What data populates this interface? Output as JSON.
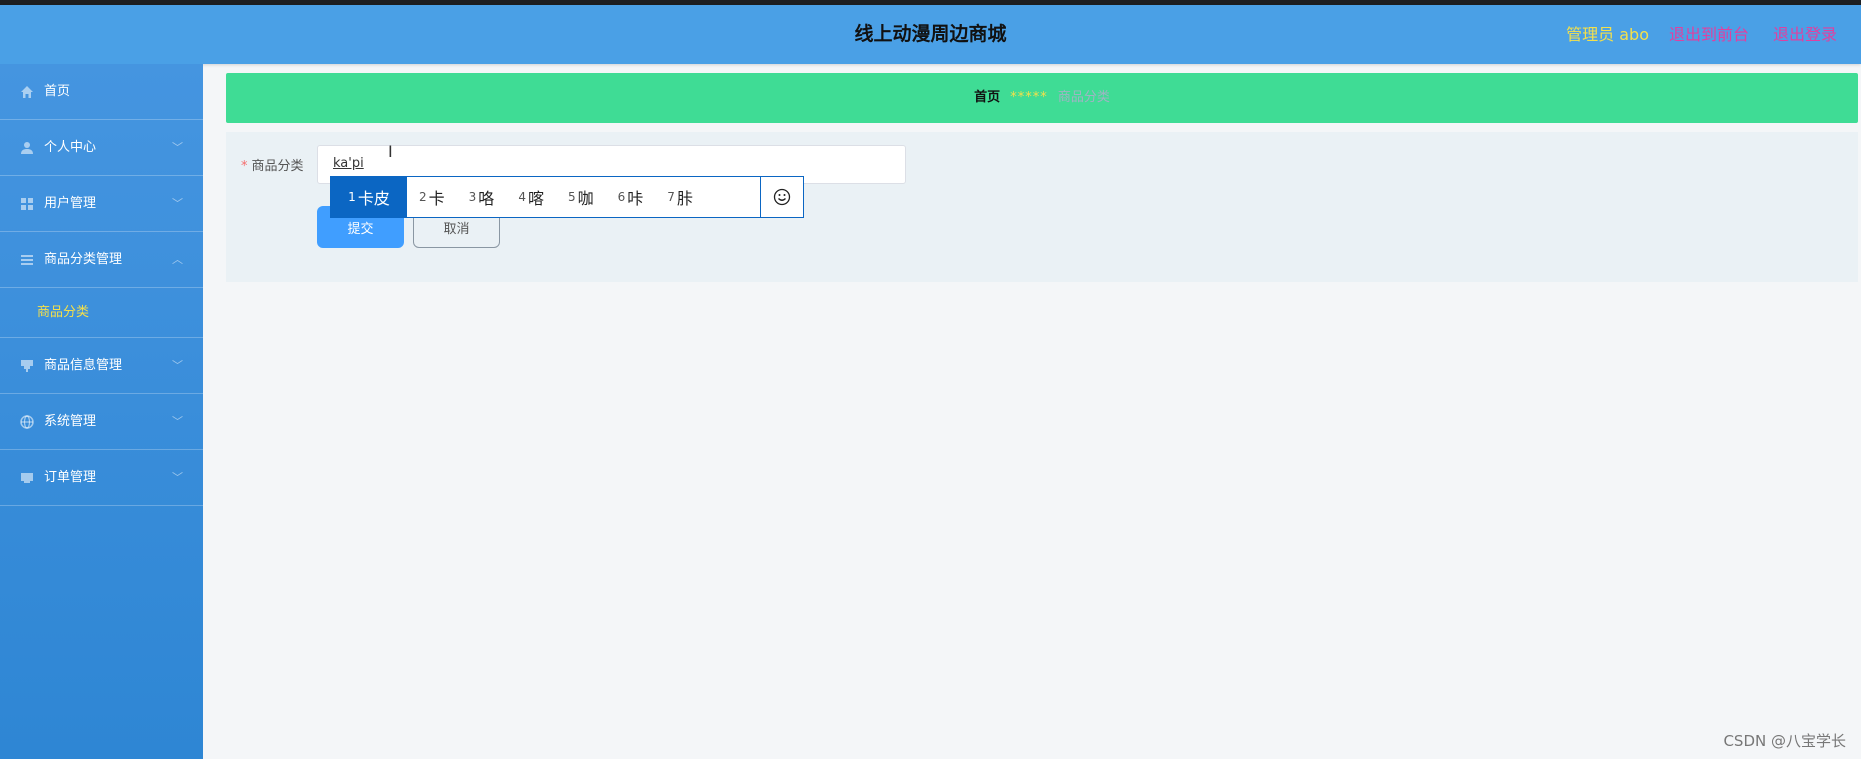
{
  "header": {
    "title": "线上动漫周边商城",
    "admin": "管理员 abo",
    "to_front": "退出到前台",
    "logout": "退出登录"
  },
  "sidebar": {
    "items": [
      {
        "label": "首页",
        "icon": "home-icon"
      },
      {
        "label": "个人中心",
        "icon": "user-icon"
      },
      {
        "label": "用户管理",
        "icon": "grid-icon"
      },
      {
        "label": "商品分类管理",
        "icon": "list-icon"
      },
      {
        "label": "商品信息管理",
        "icon": "goods-icon"
      },
      {
        "label": "系统管理",
        "icon": "globe-icon"
      },
      {
        "label": "订单管理",
        "icon": "order-icon"
      }
    ],
    "sub_item": "商品分类",
    "colors": {
      "active_sub": "#f4e04a"
    }
  },
  "breadcrumb": {
    "home": "首页",
    "separator": "*****",
    "current": "商品分类"
  },
  "form": {
    "label": "商品分类",
    "required_mark": "*",
    "input_value": "ka'pi",
    "submit": "提交",
    "cancel": "取消"
  },
  "ime": {
    "candidates": [
      {
        "num": "1",
        "text": "卡皮"
      },
      {
        "num": "2",
        "text": "卡"
      },
      {
        "num": "3",
        "text": "咯"
      },
      {
        "num": "4",
        "text": "喀"
      },
      {
        "num": "5",
        "text": "咖"
      },
      {
        "num": "6",
        "text": "咔"
      },
      {
        "num": "7",
        "text": "胩"
      }
    ],
    "emoji_icon": "smiley-icon"
  },
  "watermark": "CSDN @八宝学长"
}
